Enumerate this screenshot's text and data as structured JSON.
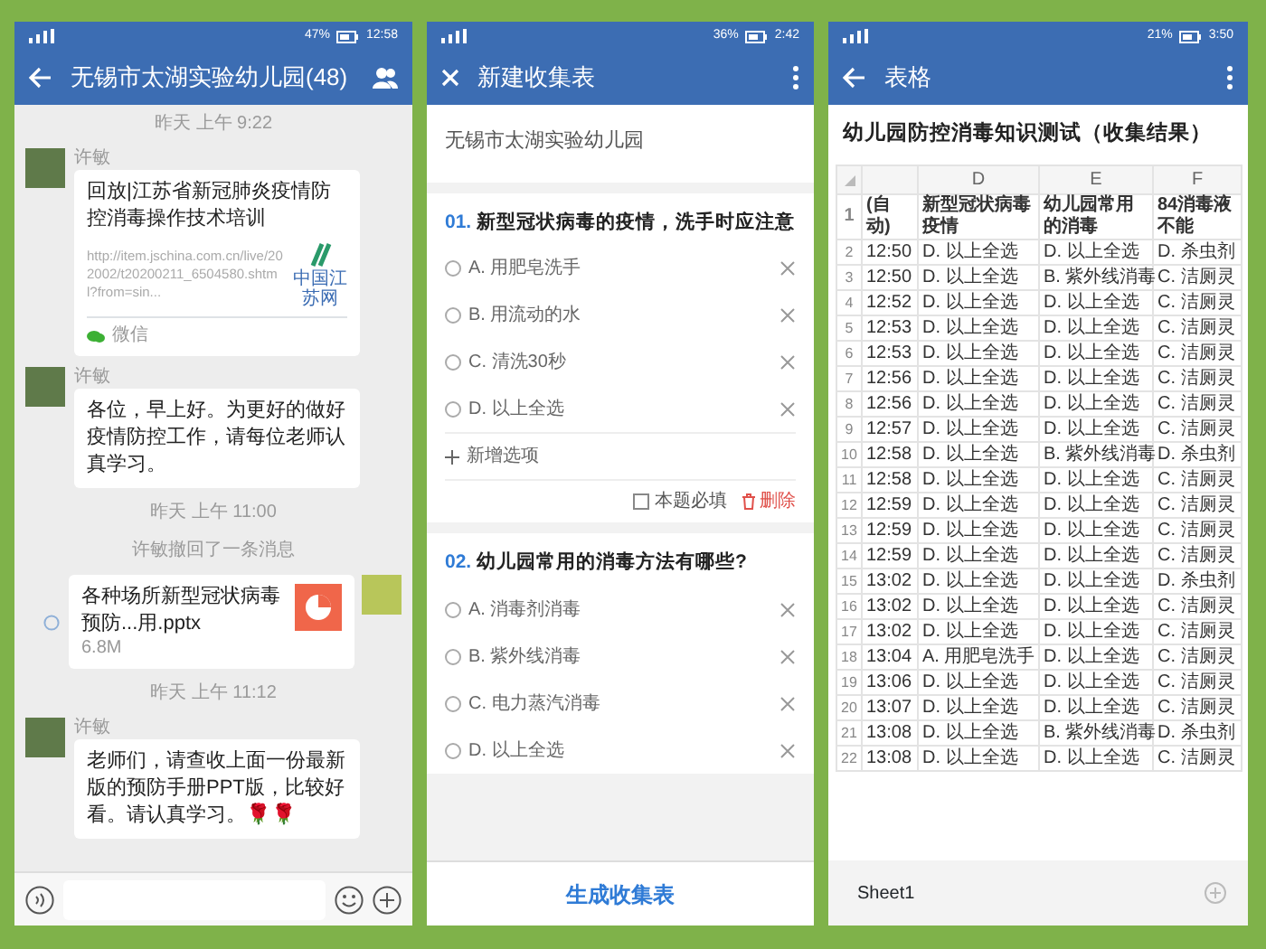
{
  "screens": [
    {
      "kind": "chat",
      "status": {
        "battery": "47%",
        "time": "12:58"
      },
      "title": "无锡市太湖实验幼儿园(48)",
      "messages": [
        {
          "kind": "time",
          "text": "昨天 上午 9:22"
        },
        {
          "kind": "link",
          "sender": "许敏",
          "title": "回放|江苏省新冠肺炎疫情防控消毒操作技术培训",
          "url": "http://item.jschina.com.cn/live/202002/t20200211_6504580.shtml?from=sin...",
          "logo_text": "中国江苏网",
          "source": "微信"
        },
        {
          "kind": "text",
          "sender": "许敏",
          "text": "各位，早上好。为更好的做好疫情防控工作，请每位老师认真学习。"
        },
        {
          "kind": "time",
          "text": "昨天 上午 11:00"
        },
        {
          "kind": "notice",
          "text": "许敏撤回了一条消息"
        },
        {
          "kind": "file",
          "name": "各种场所新型冠状病毒预防...用.pptx",
          "size": "6.8M"
        },
        {
          "kind": "time",
          "text": "昨天 上午 11:12"
        },
        {
          "kind": "text",
          "sender": "许敏",
          "text": "老师们，请查收上面一份最新版的预防手册PPT版，比较好看。请认真学习。🌹🌹"
        }
      ]
    },
    {
      "kind": "form",
      "status": {
        "battery": "36%",
        "time": "2:42"
      },
      "title": "新建收集表",
      "org": "无锡市太湖实验幼儿园",
      "questions": [
        {
          "number": "01.",
          "title": "新型冠状病毒的疫情，洗手时应注意",
          "options": [
            "A. 用肥皂洗手",
            "B. 用流动的水",
            "C. 清洗30秒",
            "D. 以上全选"
          ],
          "add_option": "新增选项",
          "required_label": "本题必填",
          "required": false,
          "delete_label": "删除"
        },
        {
          "number": "02.",
          "title": "幼儿园常用的消毒方法有哪些?",
          "options": [
            "A. 消毒剂消毒",
            "B. 紫外线消毒",
            "C. 电力蒸汽消毒",
            "D. 以上全选"
          ]
        }
      ],
      "submit": "生成收集表"
    },
    {
      "kind": "sheet",
      "status": {
        "battery": "21%",
        "time": "3:50"
      },
      "title": "表格",
      "heading": "幼儿园防控消毒知识测试（收集结果）",
      "columns": [
        "",
        "D",
        "E",
        "F"
      ],
      "rows": [
        {
          "num": "1",
          "cells": [
            "(自动)",
            "新型冠状病毒疫情",
            "幼儿园常用的消毒",
            "84消毒液不能"
          ]
        },
        {
          "num": "2",
          "cells": [
            "12:50",
            "D. 以上全选",
            "D. 以上全选",
            "D. 杀虫剂"
          ]
        },
        {
          "num": "3",
          "cells": [
            "12:50",
            "D. 以上全选",
            "B. 紫外线消毒",
            "C. 洁厕灵"
          ]
        },
        {
          "num": "4",
          "cells": [
            "12:52",
            "D. 以上全选",
            "D. 以上全选",
            "C. 洁厕灵"
          ]
        },
        {
          "num": "5",
          "cells": [
            "12:53",
            "D. 以上全选",
            "D. 以上全选",
            "C. 洁厕灵"
          ]
        },
        {
          "num": "6",
          "cells": [
            "12:53",
            "D. 以上全选",
            "D. 以上全选",
            "C. 洁厕灵"
          ]
        },
        {
          "num": "7",
          "cells": [
            "12:56",
            "D. 以上全选",
            "D. 以上全选",
            "C. 洁厕灵"
          ]
        },
        {
          "num": "8",
          "cells": [
            "12:56",
            "D. 以上全选",
            "D. 以上全选",
            "C. 洁厕灵"
          ]
        },
        {
          "num": "9",
          "cells": [
            "12:57",
            "D. 以上全选",
            "D. 以上全选",
            "C. 洁厕灵"
          ]
        },
        {
          "num": "10",
          "cells": [
            "12:58",
            "D. 以上全选",
            "B. 紫外线消毒",
            "D. 杀虫剂"
          ]
        },
        {
          "num": "11",
          "cells": [
            "12:58",
            "D. 以上全选",
            "D. 以上全选",
            "C. 洁厕灵"
          ]
        },
        {
          "num": "12",
          "cells": [
            "12:59",
            "D. 以上全选",
            "D. 以上全选",
            "C. 洁厕灵"
          ]
        },
        {
          "num": "13",
          "cells": [
            "12:59",
            "D. 以上全选",
            "D. 以上全选",
            "C. 洁厕灵"
          ]
        },
        {
          "num": "14",
          "cells": [
            "12:59",
            "D. 以上全选",
            "D. 以上全选",
            "C. 洁厕灵"
          ]
        },
        {
          "num": "15",
          "cells": [
            "13:02",
            "D. 以上全选",
            "D. 以上全选",
            "D. 杀虫剂"
          ]
        },
        {
          "num": "16",
          "cells": [
            "13:02",
            "D. 以上全选",
            "D. 以上全选",
            "C. 洁厕灵"
          ]
        },
        {
          "num": "17",
          "cells": [
            "13:02",
            "D. 以上全选",
            "D. 以上全选",
            "C. 洁厕灵"
          ]
        },
        {
          "num": "18",
          "cells": [
            "13:04",
            "A. 用肥皂洗手",
            "D. 以上全选",
            "C. 洁厕灵"
          ]
        },
        {
          "num": "19",
          "cells": [
            "13:06",
            "D. 以上全选",
            "D. 以上全选",
            "C. 洁厕灵"
          ]
        },
        {
          "num": "20",
          "cells": [
            "13:07",
            "D. 以上全选",
            "D. 以上全选",
            "C. 洁厕灵"
          ]
        },
        {
          "num": "21",
          "cells": [
            "13:08",
            "D. 以上全选",
            "B. 紫外线消毒",
            "D. 杀虫剂"
          ]
        },
        {
          "num": "22",
          "cells": [
            "13:08",
            "D. 以上全选",
            "D. 以上全选",
            "C. 洁厕灵"
          ]
        }
      ],
      "sheet_tab": "Sheet1"
    }
  ]
}
